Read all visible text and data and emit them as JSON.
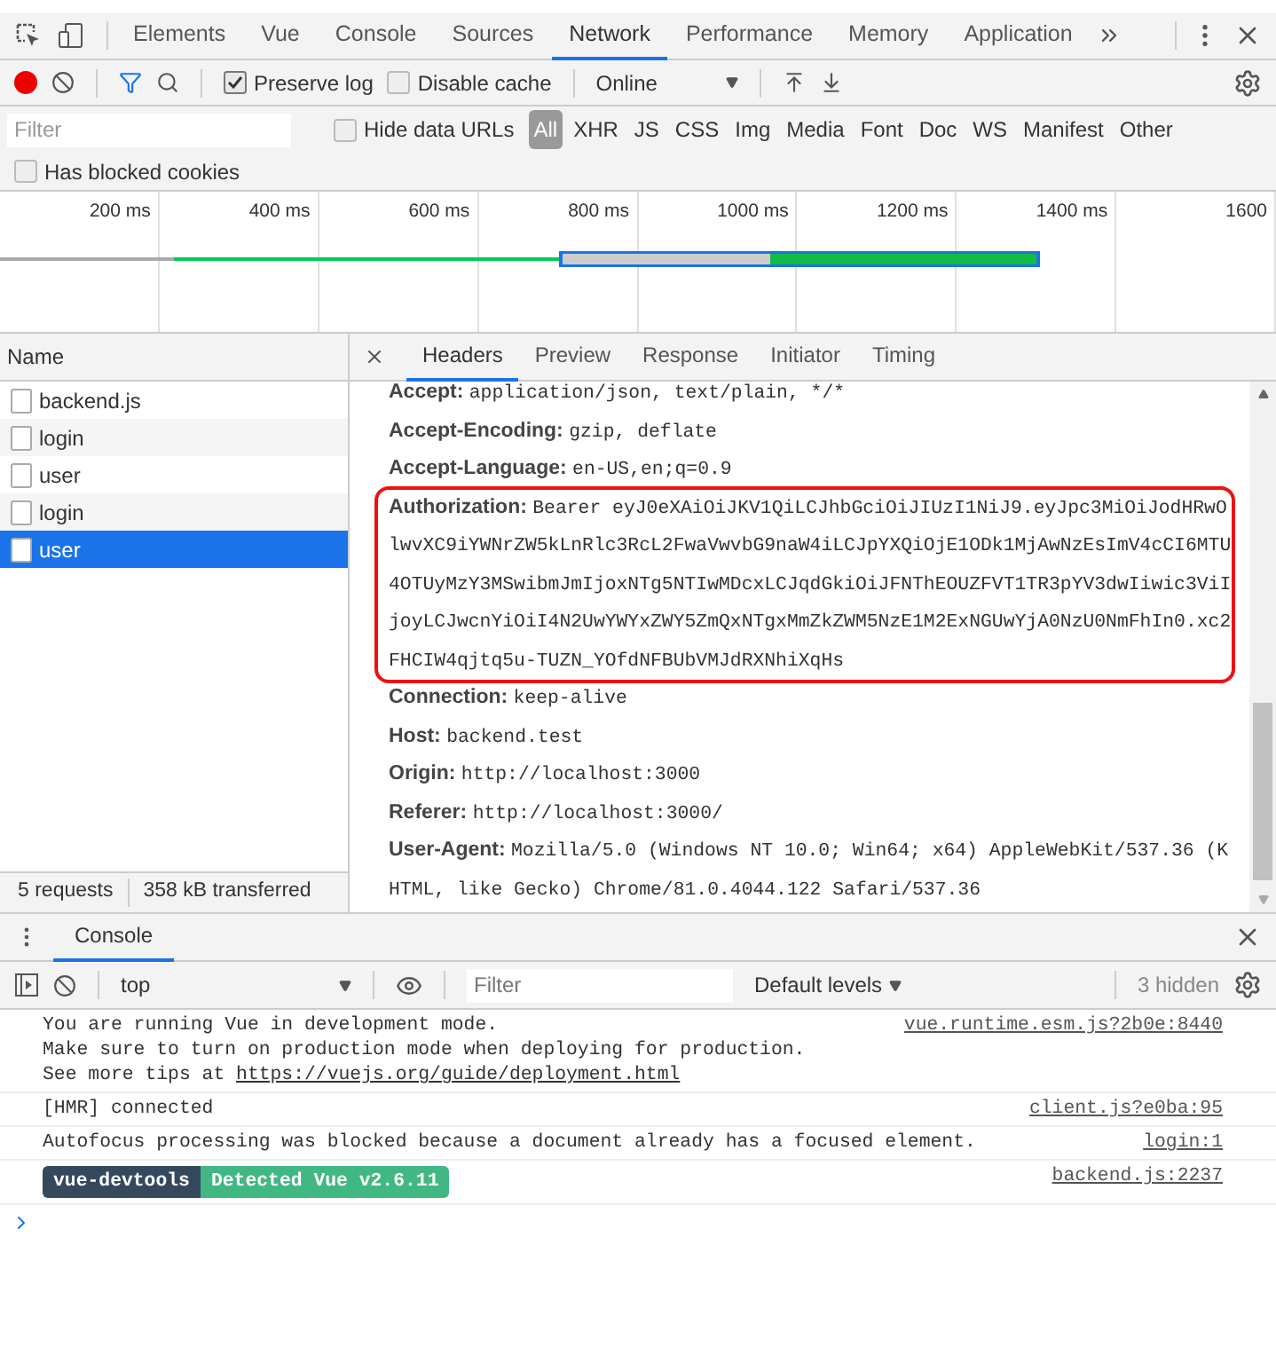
{
  "devtools_tabs": [
    {
      "label": "Elements",
      "selected": false
    },
    {
      "label": "Vue",
      "selected": false
    },
    {
      "label": "Console",
      "selected": false
    },
    {
      "label": "Sources",
      "selected": false
    },
    {
      "label": "Network",
      "selected": true
    },
    {
      "label": "Performance",
      "selected": false
    },
    {
      "label": "Memory",
      "selected": false
    },
    {
      "label": "Application",
      "selected": false
    }
  ],
  "toolbar": {
    "recording": true,
    "preserve_log": {
      "label": "Preserve log",
      "checked": true
    },
    "disable_cache": {
      "label": "Disable cache",
      "checked": false
    },
    "throttling": "Online"
  },
  "filter_bar": {
    "placeholder": "Filter",
    "hide_data_urls": {
      "label": "Hide data URLs",
      "checked": false
    },
    "types": [
      {
        "label": "All",
        "selected": true
      },
      {
        "label": "XHR",
        "selected": false
      },
      {
        "label": "JS",
        "selected": false
      },
      {
        "label": "CSS",
        "selected": false
      },
      {
        "label": "Img",
        "selected": false
      },
      {
        "label": "Media",
        "selected": false
      },
      {
        "label": "Font",
        "selected": false
      },
      {
        "label": "Doc",
        "selected": false
      },
      {
        "label": "WS",
        "selected": false
      },
      {
        "label": "Manifest",
        "selected": false
      },
      {
        "label": "Other",
        "selected": false
      }
    ],
    "blocked_cookies": {
      "label": "Has blocked cookies",
      "checked": false
    }
  },
  "timeline": {
    "ticks": [
      "200 ms",
      "400 ms",
      "600 ms",
      "800 ms",
      "1000 ms",
      "1200 ms",
      "1400 ms",
      "1600"
    ]
  },
  "requests": {
    "column": "Name",
    "items": [
      {
        "name": "backend.js",
        "selected": false
      },
      {
        "name": "login",
        "selected": false
      },
      {
        "name": "user",
        "selected": false
      },
      {
        "name": "login",
        "selected": false
      },
      {
        "name": "user",
        "selected": true
      }
    ],
    "summary": [
      "5 requests",
      "358 kB transferred"
    ]
  },
  "detail_tabs": [
    {
      "label": "Headers",
      "selected": true
    },
    {
      "label": "Preview",
      "selected": false
    },
    {
      "label": "Response",
      "selected": false
    },
    {
      "label": "Initiator",
      "selected": false
    },
    {
      "label": "Timing",
      "selected": false
    }
  ],
  "headers": [
    {
      "name": "Accept:",
      "value": "application/json, text/plain, */*",
      "highlighted": false
    },
    {
      "name": "Accept-Encoding:",
      "value": "gzip, deflate",
      "highlighted": false
    },
    {
      "name": "Accept-Language:",
      "value": "en-US,en;q=0.9",
      "highlighted": false
    },
    {
      "name": "Authorization:",
      "value": "Bearer eyJ0eXAiOiJKV1QiLCJhbGciOiJIUzI1NiJ9.eyJpc3MiOiJodHRwOlwvXC9iYWNrZW5kLnRlc3RcL2FwaVwvbG9naW4iLCJpYXQiOjE1ODk1MjAwNzEsImV4cCI6MTU4OTUyMzY3MSwibmJmIjoxNTg5NTIwMDcxLCJqdGkiOiJFNThEOUZFVT1TR3pYV3dwIiwic3ViIjoyLCJwcnYiOiI4N2UwYWYxZWY5ZmQxNTgxMmZkZWM5NzE1M2ExNGUwYjA0NzU0NmFhIn0.xc2FHCIW4qjtq5u-TUZN_YOfdNFBUbVMJdRXNhiXqHs",
      "highlighted": true
    },
    {
      "name": "Connection:",
      "value": "keep-alive",
      "highlighted": false
    },
    {
      "name": "Host:",
      "value": "backend.test",
      "highlighted": false
    },
    {
      "name": "Origin:",
      "value": "http://localhost:3000",
      "highlighted": false
    },
    {
      "name": "Referer:",
      "value": "http://localhost:3000/",
      "highlighted": false
    },
    {
      "name": "User-Agent:",
      "value": "Mozilla/5.0 (Windows NT 10.0; Win64; x64) AppleWebKit/537.36 (KHTML, like Gecko) Chrome/81.0.4044.122 Safari/537.36",
      "highlighted": false
    }
  ],
  "console": {
    "tab": "Console",
    "context": "top",
    "filter_placeholder": "Filter",
    "levels": "Default levels",
    "hidden": "3 hidden",
    "messages": [
      {
        "kind": "text",
        "lines": [
          "You are running Vue in development mode.",
          "Make sure to turn on production mode when deploying for production."
        ],
        "prefix": "See more tips at ",
        "link": "https://vuejs.org/guide/deployment.html",
        "source": "vue.runtime.esm.js?2b0e:8440"
      },
      {
        "kind": "text",
        "lines": [
          "[HMR] connected"
        ],
        "source": "client.js?e0ba:95"
      },
      {
        "kind": "text",
        "lines": [
          "Autofocus processing was blocked because a document already has a focused element."
        ],
        "source": "login:1"
      },
      {
        "kind": "badge",
        "badges": [
          "vue-devtools",
          "Detected Vue v2.6.11"
        ],
        "source": "backend.js:2237"
      }
    ]
  }
}
